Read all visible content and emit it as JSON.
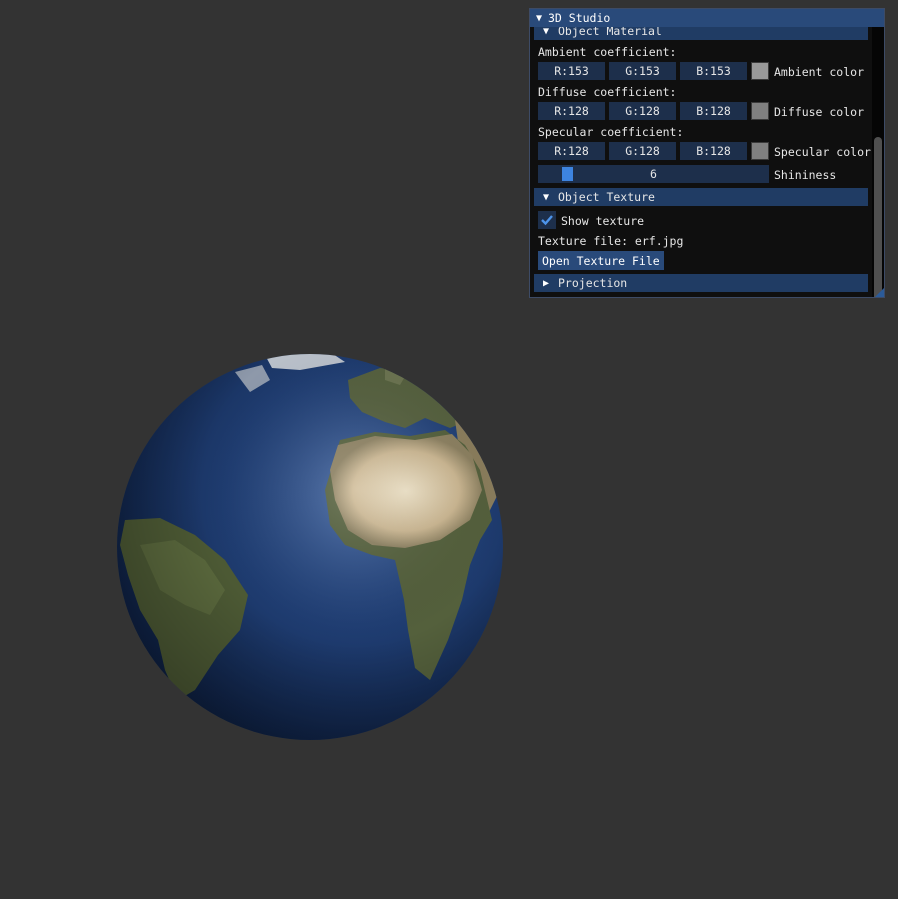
{
  "window": {
    "title": "3D Studio",
    "title_arrow": "▼"
  },
  "material": {
    "header": "Object Material",
    "arrow": "▼",
    "ambient": {
      "label": "Ambient coefficient:",
      "r": "R:153",
      "g": "G:153",
      "b": "B:153",
      "color_label": "Ambient color",
      "color": "#999999"
    },
    "diffuse": {
      "label": "Diffuse coefficient:",
      "r": "R:128",
      "g": "G:128",
      "b": "B:128",
      "color_label": "Diffuse color",
      "color": "#808080"
    },
    "specular": {
      "label": "Specular coefficient:",
      "r": "R:128",
      "g": "G:128",
      "b": "B:128",
      "color_label": "Specular color",
      "color": "#808080"
    },
    "shininess": {
      "value": "6",
      "label": "Shininess"
    }
  },
  "texture": {
    "header": "Object Texture",
    "arrow": "▼",
    "show_texture_label": "Show texture",
    "show_texture_checked": true,
    "file_text": "Texture file: erf.jpg",
    "open_button": "Open Texture File"
  },
  "projection": {
    "header": "Projection",
    "arrow": "▶"
  },
  "scene": {
    "background": "#333333",
    "object": "textured earth globe",
    "ocean_color": "#1e3a6e",
    "land_color": "#4d5a36",
    "desert_color": "#d8c6a0"
  }
}
